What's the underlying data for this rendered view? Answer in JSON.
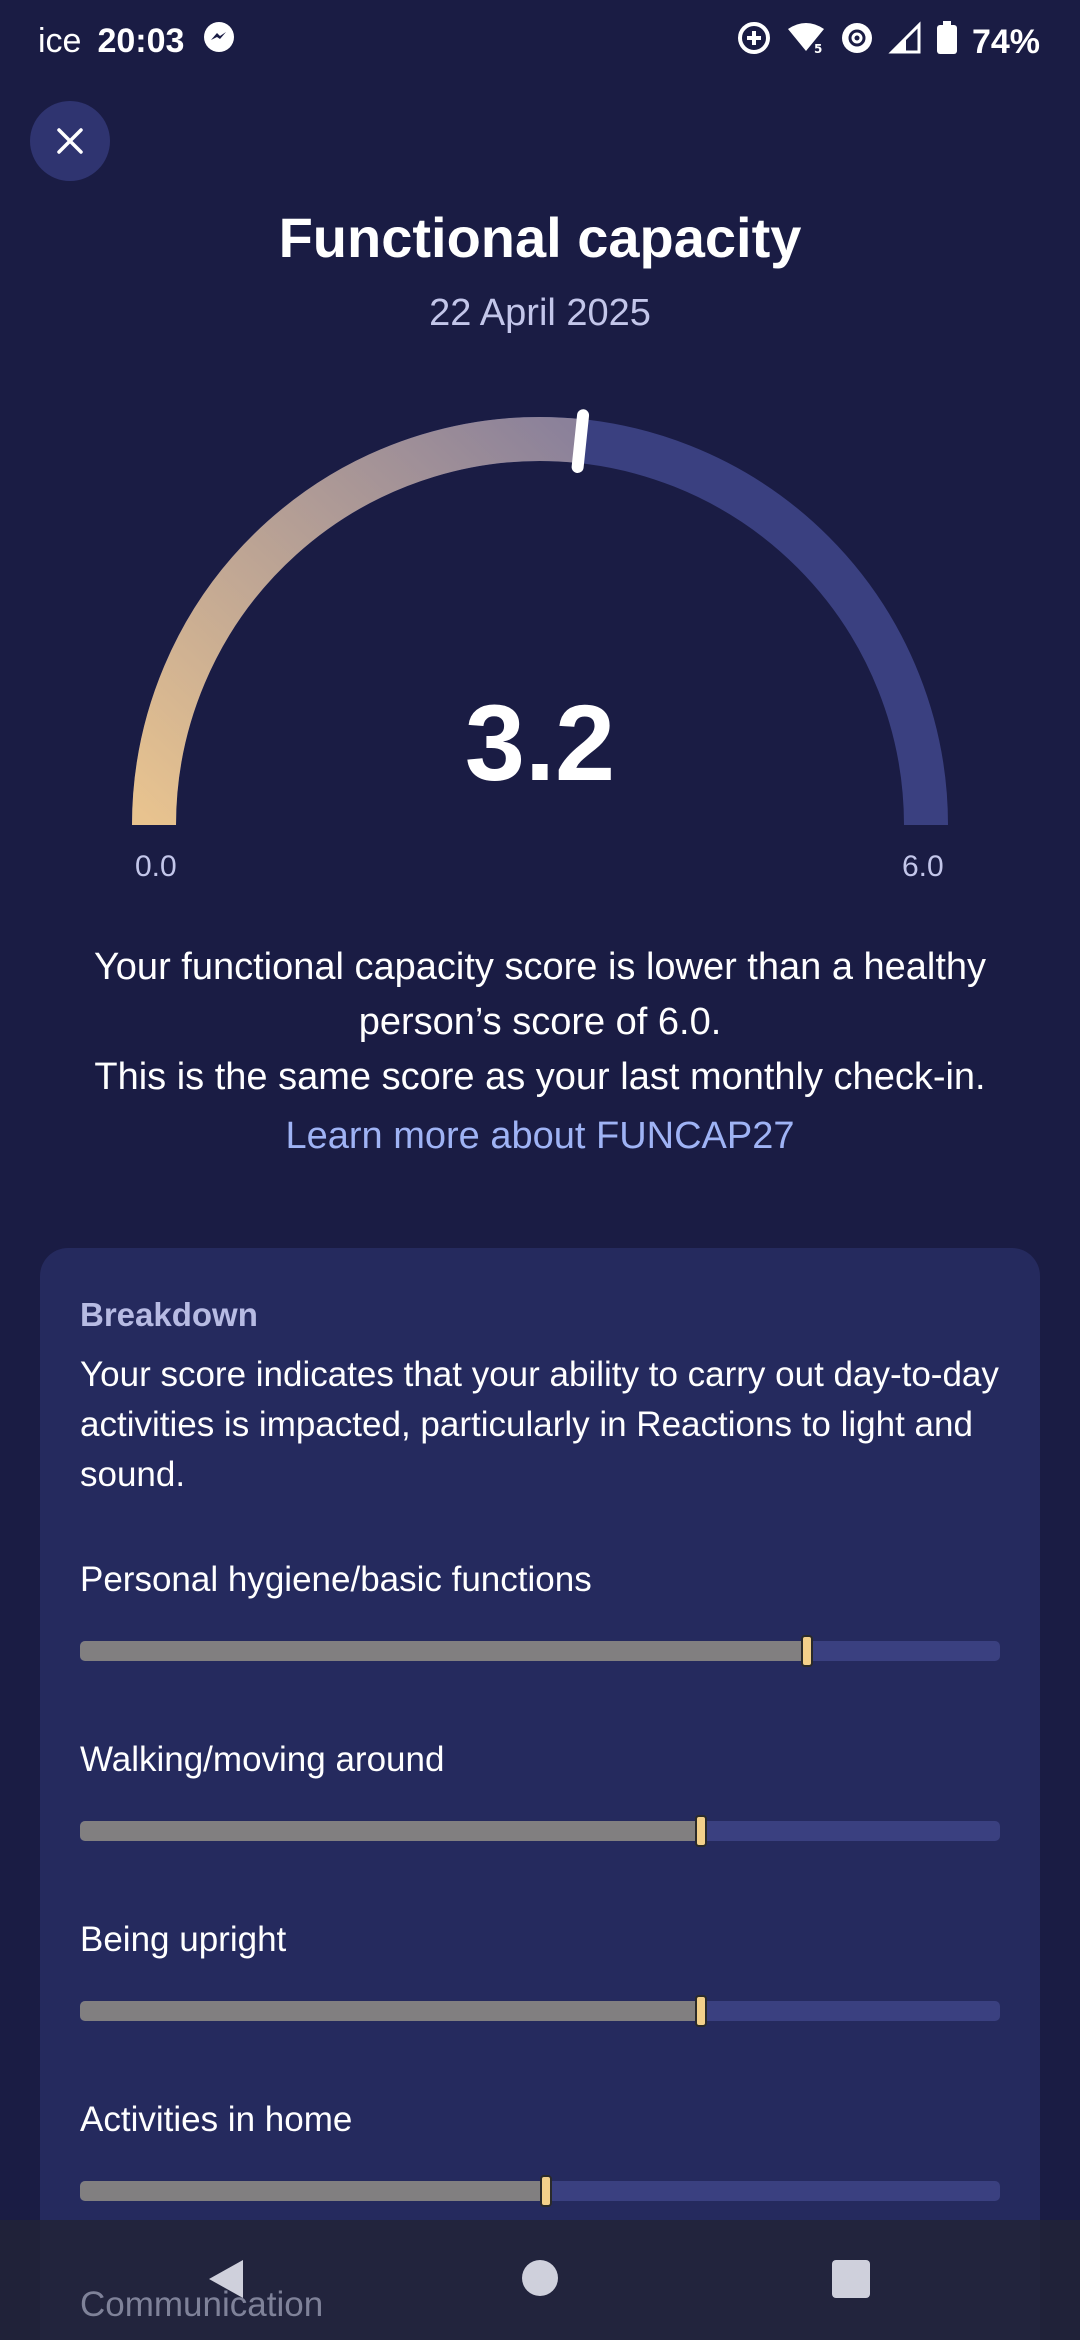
{
  "status_bar": {
    "carrier": "ice",
    "time": "20:03",
    "battery": "74%",
    "icons": [
      "messenger-icon",
      "data-saver-icon",
      "wifi-icon",
      "hotspot-icon",
      "signal-icon",
      "battery-icon"
    ]
  },
  "header": {
    "title": "Functional capacity",
    "date": "22 April 2025"
  },
  "gauge": {
    "score": "3.2",
    "min_label": "0.0",
    "max_label": "6.0",
    "value": 3.2,
    "min": 0,
    "max": 6,
    "colors": {
      "fill_start": "#e8c38f",
      "fill_end": "#8b819a",
      "track": "#3a4080"
    }
  },
  "summary": {
    "line1": "Your functional capacity score is lower than a healthy person’s score of 6.0.",
    "line2": "This is the same score as your last monthly check-in.",
    "link": "Learn more about FUNCAP27"
  },
  "breakdown": {
    "heading": "Breakdown",
    "description": "Your score indicates that your ability to carry out day-to-day activities is impacted, particularly in Reactions to light and sound.",
    "items": [
      {
        "label": "Personal hygiene/basic functions",
        "fraction": 0.79
      },
      {
        "label": "Walking/moving around",
        "fraction": 0.675
      },
      {
        "label": "Being upright",
        "fraction": 0.675
      },
      {
        "label": "Activities in home",
        "fraction": 0.507
      }
    ],
    "peek_label": "Communication"
  }
}
